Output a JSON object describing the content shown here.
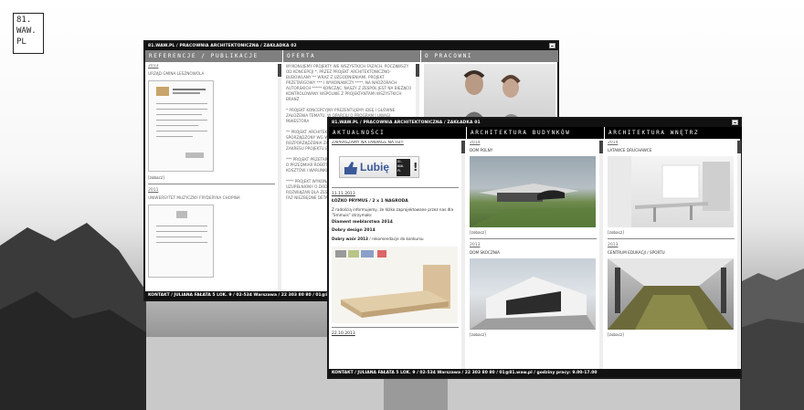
{
  "logo": {
    "lines": [
      "81.",
      "WAW.",
      "PL"
    ]
  },
  "window_back": {
    "title": "81.WAW.PL / PRACOWNIA ARCHITEKTONICZNA / ZAKŁADKA 02",
    "footer": "KONTAKT / JULIANA FAŁATA 5 LOK. 9 / 02-534 Warszawa / 22 303 80 80 / 01@81.waw.pl",
    "col1": {
      "heading": "REFERENCJE / PUBLIKACJE",
      "year1": "2013",
      "item1": "URZĄD GMINA LESZNOWOLA",
      "more": "[zobacz]",
      "year2": "2011",
      "item2": "UNIWERSYTET MUZYCZNY FRYDERYKA CHOPINA"
    },
    "col2": {
      "heading": "OFERTA",
      "para1": "WYKONUJEMY PROJEKTY WE WSZYSTKICH FAZACH, POCZĄWSZY OD KONCEPCJI *, PRZEZ PROJEKT ARCHITEKTONICZNO-BUDOWLANY ** WRAZ Z UZGODNIENIAMI, PROJEKT PRZETARGOWY *** I WYKONAWCZY ****, NA NADZORACH AUTORSKICH ***** KOŃCZĄC. NASZY Z ZESPÓŁ JEST NA BIEŻĄCO KONTROLOWANY WSPÓLNIE Z PROJEKTANTAMI WSZYSTKICH BRANŻ",
      "para2": "* PROJEKT KONCEPCYJNY PREZENTUJEMY IDEĘ I GŁÓWNE ZAŁOŻENIA TEMATU, W OPARCIU O PROGRAM I UWAGI INWESTORA",
      "para3": "** PROJEKT ARCHITEKTONICZNO-BUDOWLANY PROJEKT SPORZĄDZONY WG WYMAGAŃ PRAWA BUDOWLANEGO DO ROZPORZĄDZENIA ZAWIERA SPRAWIE SZCZEGÓŁOWEGO ZAKRESU PROJEKTU BUDOWLANEGO / PROJEKTU",
      "para4": "*** PROJEKT PRZETARGOWY PROJEKT BUDOWLANY UZUPEŁNIONY O PRZEDMIAR ROBÓT BUDOWLANYCH W CELU OSZACOWANIA KOSZTÓW I WARUNKÓW",
      "para5": "**** PROJEKT WYKONAWCZY PROJEKT PRZETARGOWY UZUPEŁNIONY O DODATKOWE OPRACOWANIA DOTYCZĄCE ROZWIĄZAŃ DLA ZESPOŁU USZCZEGÓŁOWIENIE POPRZEDNICH FAZ NIEZBĘDNE DETALE"
    },
    "col3": {
      "heading": "O PRACOWNI"
    }
  },
  "window_front": {
    "title": "81.WAW.PL / PRACOWNIA ARCHITEKTONICZNA / ZAKŁADKA 01",
    "footer": "KONTAKT / JULIANA FAŁATA 5 LOK. 9 / 02-534 Warszawa / 22 303 80 80 / 01@81.waw.pl / godziny pracy: 9.00-17.00",
    "news": {
      "heading": "AKTUALNOŚCI",
      "fb_invite": "ZAPRASZAMY NA FANPAGE NA FB!!",
      "fb_label": "Lubię",
      "fb_logo": "81. WAW. PL",
      "date1": "11.11.2013",
      "post_title": "ŁÓŻKO PRYMUS / 2 x 1 NAGRODA",
      "post_text": "Z radością informujemy, że łóżko zaprojektowane przez nas dla \"Smmuis\" otrzymało:",
      "award1": "Diament meblarstwa 2014",
      "award2": "Dobry design 2014",
      "award3": "Dobry wzór 2013",
      "award3_note": " / rekomendacje do konkursu",
      "date2": "22.10.2013"
    },
    "buildings": {
      "heading": "ARCHITEKTURA BUDYNKÓW",
      "items": [
        {
          "year": "2014",
          "name": "DOM POLNY",
          "more": "[zobacz]"
        },
        {
          "year": "2013",
          "name": "DOM SKOCZNIA",
          "more": "[zobacz]"
        }
      ]
    },
    "interiors": {
      "heading": "ARCHITEKTURA WNĘTRZ",
      "items": [
        {
          "year": "2014",
          "name": "LATAWCE DRUCHAWCE",
          "more": "[zobacz]"
        },
        {
          "year": "2013",
          "name": "CENTRUM EDUKACJI / SPORTU",
          "more": "[zobacz]"
        }
      ]
    }
  }
}
